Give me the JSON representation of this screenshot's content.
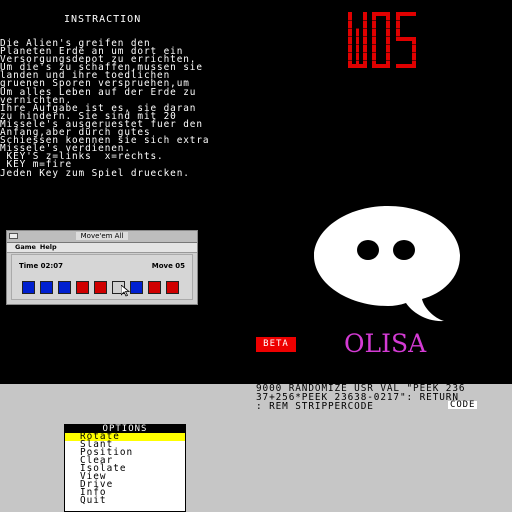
{
  "instructions": {
    "title": "INSTRACTION",
    "body": "Die Alien's greifen den\nPlaneten Erde an um dort ein\nVersorgungsdepot zu errichten.\nUm die's zu schaffen,mussen sie\nlanden und ihre toedlichen\ngruenen Sporen verspruehen,um\nUm alles Leben auf der Erde zu\nvernichten.\nIhre Aufgabe ist es, sie daran\nzu hindern. Sie sind mit 20\nMissele's ausgeruestet fuer den\nAnfang,aber durch gutes\nSchiessen koennen sie sich extra\nMissele's verdienen.\n KEY'S z=links  x=rechts.\n KEY m=fire\nJeden Key zum Spiel druecken."
  },
  "logo": {
    "text": "WOS",
    "color": "#e00000"
  },
  "window": {
    "title": "Move'em All",
    "menu": [
      "Game",
      "Help"
    ],
    "time_label": "Time 02:07",
    "moves_label": "Move 05",
    "tiles": [
      "#0020d0",
      "#0020d0",
      "#0020d0",
      "#d00000",
      "#d00000",
      "#d0d0d0",
      "#0020d0",
      "#d00000",
      "#d00000"
    ]
  },
  "badge": {
    "beta": "BETA"
  },
  "brand": {
    "olisa": "OLISA"
  },
  "basic": {
    "lines": "9000 RANDOMIZE USR VAL \"PEEK 236\n37+256*PEEK 23638-0217\": RETURN\n: REM STRIPPERCODE",
    "code_label": "CODE"
  },
  "options": {
    "title": "OPTIONS",
    "items": [
      "Rotate",
      "Slant",
      "Position",
      "Clear",
      "Isolate",
      "View",
      "Drive",
      "Info",
      "Quit"
    ],
    "selected": 0
  },
  "colors": {
    "bubble": "#ffffff",
    "beta_bg": "#e00000",
    "olisa": "#d43bd4",
    "highlight": "#ffff00"
  }
}
